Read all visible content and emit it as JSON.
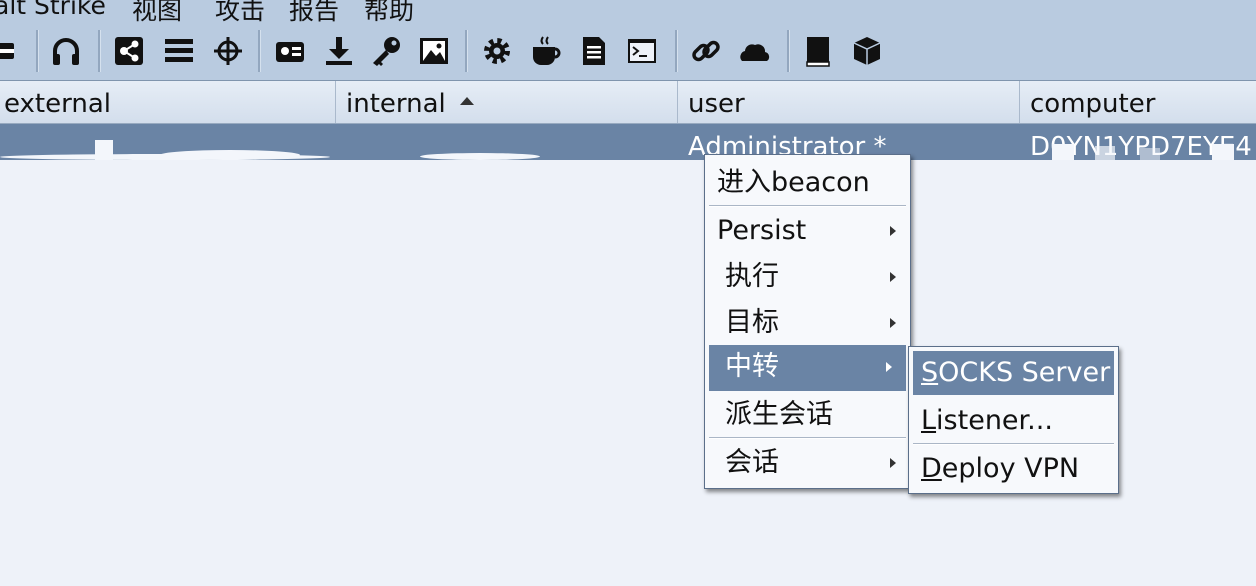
{
  "menubar": {
    "items": [
      "alt Strike",
      "视图",
      "攻击",
      "报告",
      "帮助"
    ]
  },
  "toolbar": {
    "buttons": [
      "disconnect-icon",
      "headphones-icon",
      "pivot-graph-icon",
      "session-table-icon",
      "target-crosshair-icon",
      "credentials-icon",
      "download-icon",
      "key-icon",
      "screenshot-icon",
      "gear-icon",
      "coffee-cup-icon",
      "document-icon",
      "console-icon",
      "link-icon",
      "cloud-icon",
      "book-icon",
      "cube-icon"
    ]
  },
  "table": {
    "columns": [
      "external",
      "internal",
      "user",
      "computer"
    ],
    "sorted_column": "internal",
    "row": {
      "user": "Administrator *",
      "computer": "D0YN1YPD7EYE4"
    }
  },
  "context_menu": {
    "items": [
      "进入beacon",
      "Persist",
      "执行",
      "目标",
      "中转",
      "派生会话",
      "会话"
    ],
    "selected": "中转"
  },
  "submenu": {
    "socks": {
      "mnemonic": "S",
      "rest": "OCKS Server"
    },
    "listener": {
      "mnemonic": "L",
      "rest": "istener..."
    },
    "vpn": {
      "mnemonic": "D",
      "rest": "eploy VPN"
    }
  },
  "colors": {
    "toolbar": "#b9cbe0",
    "selection": "#6a84a5",
    "background": "#eef2f9"
  }
}
